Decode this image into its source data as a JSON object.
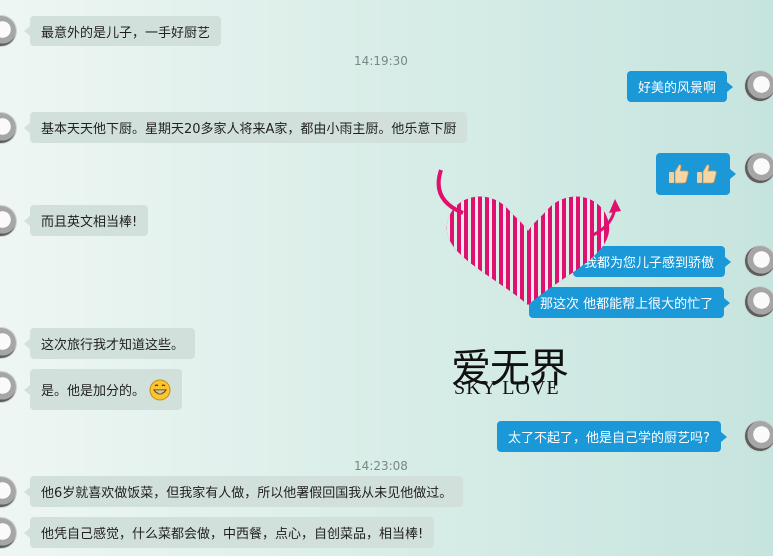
{
  "timestamps": {
    "t1": "14:19:30",
    "t2": "14:23:08"
  },
  "messages": {
    "m1": "最意外的是儿子，一手好厨艺",
    "m2": "好美的风景啊",
    "m3": "基本天天他下厨。星期天20多家人将来A家，都由小雨主厨。他乐意下厨",
    "m5": "而且英文相当棒!",
    "m6": "我都为您儿子感到骄傲",
    "m7": "那这次 他都能帮上很大的忙了",
    "m8": "这次旅行我才知道这些。",
    "m9": "是。他是加分的。",
    "m10": "太了不起了，他是自己学的厨艺吗?",
    "m11": "他6岁就喜欢做饭菜，但我家有人做，所以他署假回国我从未见他做过。",
    "m12": "他凭自己感觉，什么菜都会做，中西餐，点心，自创菜品，相当棒!"
  },
  "icons": {
    "thumbs": "thumbs-up-icon",
    "grin": "grinning-face-icon"
  },
  "watermark": {
    "title": "爱无界",
    "subtitle": "SKY LOVE"
  },
  "colors": {
    "outgoing": "#1a98d8",
    "incoming": "#d2e0dc",
    "logo": "#e0106e"
  }
}
